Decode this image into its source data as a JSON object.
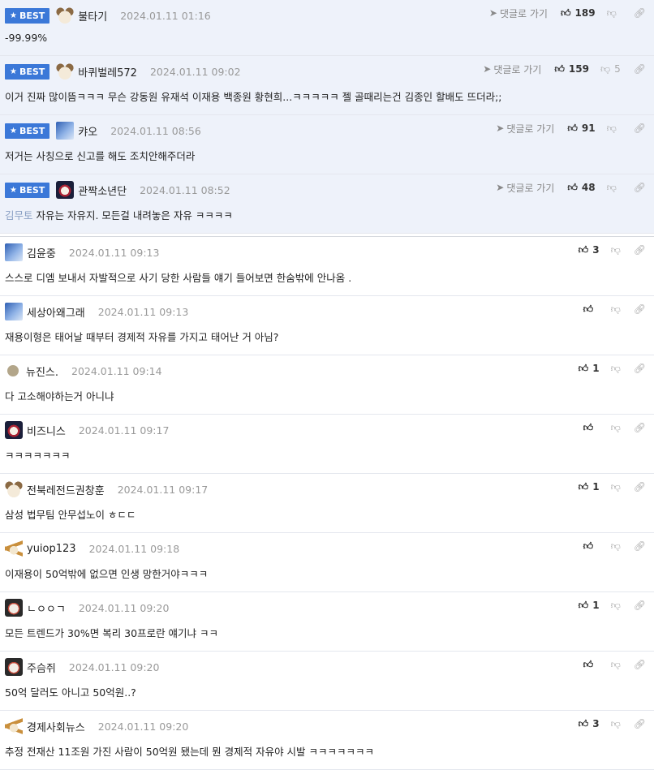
{
  "best_label": "BEST",
  "reply_label": "댓글로 가기",
  "best_comments": [
    {
      "nick": "불타기",
      "date": "2024.01.11 01:16",
      "up": "189",
      "down": "",
      "text": "-99.99%",
      "mention": "",
      "avatar": "av-dog"
    },
    {
      "nick": "바퀴벌레572",
      "date": "2024.01.11 09:02",
      "up": "159",
      "down": "5",
      "text": "이거 진짜 많이뜸ㅋㅋㅋ 무슨 강동원 유재석 이재용 백종원 황현희...ㅋㅋㅋㅋㅋ 젤 골때리는건 김종인 할배도 뜨더라;;",
      "mention": "",
      "avatar": "av-dog"
    },
    {
      "nick": "캬오",
      "date": "2024.01.11 08:56",
      "up": "91",
      "down": "",
      "text": "저거는 사칭으로 신고를 해도 조치안해주더라",
      "mention": "",
      "avatar": "av-blue"
    },
    {
      "nick": "관짝소년단",
      "date": "2024.01.11 08:52",
      "up": "48",
      "down": "",
      "text": "자유는 자유지. 모든걸 내려놓은 자유 ㅋㅋㅋㅋ",
      "mention": "김무토",
      "avatar": "av-fire"
    }
  ],
  "comments": [
    {
      "nick": "김윤중",
      "date": "2024.01.11 09:13",
      "up": "3",
      "text": "스스로 디엠 보내서 자발적으로 사기 당한 사람들 얘기 들어보면 한숨밖에 안나옴 .",
      "avatar": "av-blue"
    },
    {
      "nick": "세상아왜그래",
      "date": "2024.01.11 09:13",
      "up": "",
      "text": "재용이형은 태어날 때부터 경제적 자유를 가지고 태어난 거 아님?",
      "avatar": "av-blue"
    },
    {
      "nick": "뉴진스.",
      "date": "2024.01.11 09:14",
      "up": "1",
      "text": "다 고소해야하는거 아니냐",
      "avatar": "av-ball"
    },
    {
      "nick": "비즈니스",
      "date": "2024.01.11 09:17",
      "up": "",
      "text": "ㅋㅋㅋㅋㅋㅋㅋ",
      "avatar": "av-fire"
    },
    {
      "nick": "전북레전드권창훈",
      "date": "2024.01.11 09:17",
      "up": "1",
      "text": "삼성 법무팀 안무섭노이 ㅎㄷㄷ",
      "avatar": "av-dog"
    },
    {
      "nick": "yuiop123",
      "date": "2024.01.11 09:18",
      "up": "",
      "text": "이재용이 50억밖에 없으면 인생 망한거야ㅋㅋㅋ",
      "avatar": "av-chi"
    },
    {
      "nick": "ㄴㅇㅇㄱ",
      "date": "2024.01.11 09:20",
      "up": "1",
      "text": "모든 트렌드가 30%면 복리 30프로란 얘기냐 ㅋㅋ",
      "avatar": "av-pup"
    },
    {
      "nick": "주슴쥐",
      "date": "2024.01.11 09:20",
      "up": "",
      "text": "50억 달러도 아니고 50억원..?",
      "avatar": "av-pup"
    },
    {
      "nick": "경제사회뉴스",
      "date": "2024.01.11 09:20",
      "up": "3",
      "text": "추정 전재산 11조원 가진 사람이 50억원 됐는데 뭔 경제적 자유야 시발 ㅋㅋㅋㅋㅋㅋㅋ",
      "avatar": "av-chi"
    }
  ]
}
